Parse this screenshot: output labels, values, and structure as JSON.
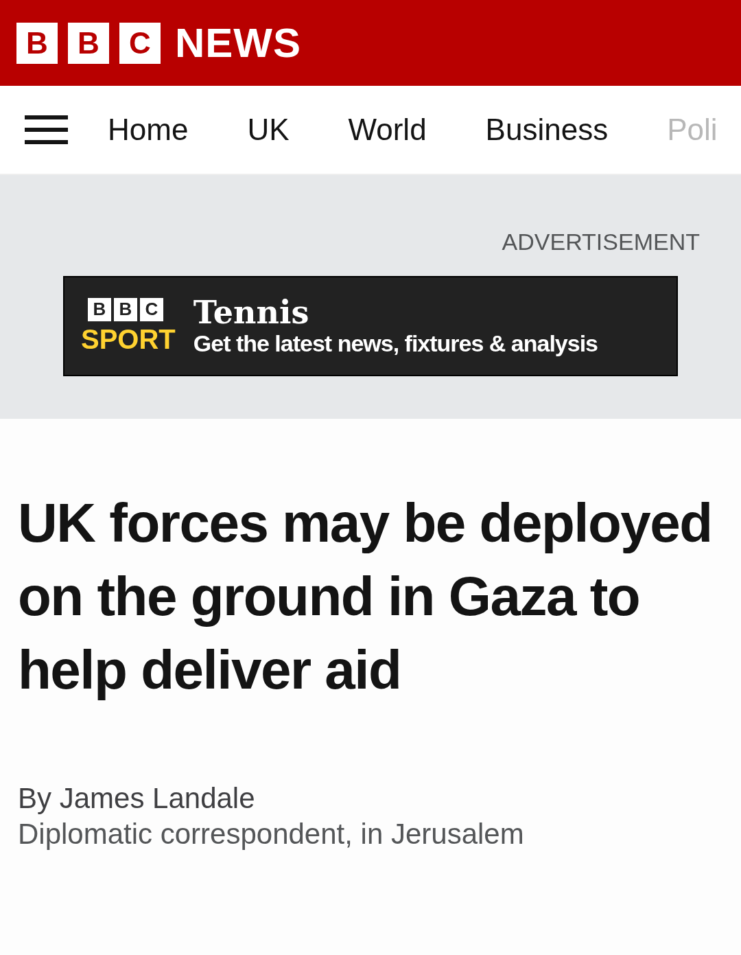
{
  "header": {
    "logo_letters": [
      "B",
      "B",
      "C"
    ],
    "brand": "NEWS"
  },
  "nav": {
    "items": [
      "Home",
      "UK",
      "World",
      "Business",
      "Poli"
    ]
  },
  "advertisement": {
    "label": "ADVERTISEMENT",
    "banner": {
      "logo_letters": [
        "B",
        "B",
        "C"
      ],
      "logo_word": "SPORT",
      "title": "Tennis",
      "tagline": "Get the latest news, fixtures & analysis"
    }
  },
  "article": {
    "headline": "UK forces may be deployed on the ground in Gaza to help deliver aid",
    "byline": {
      "author": "By James Landale",
      "role": "Diplomatic correspondent, in Jerusalem"
    }
  }
}
